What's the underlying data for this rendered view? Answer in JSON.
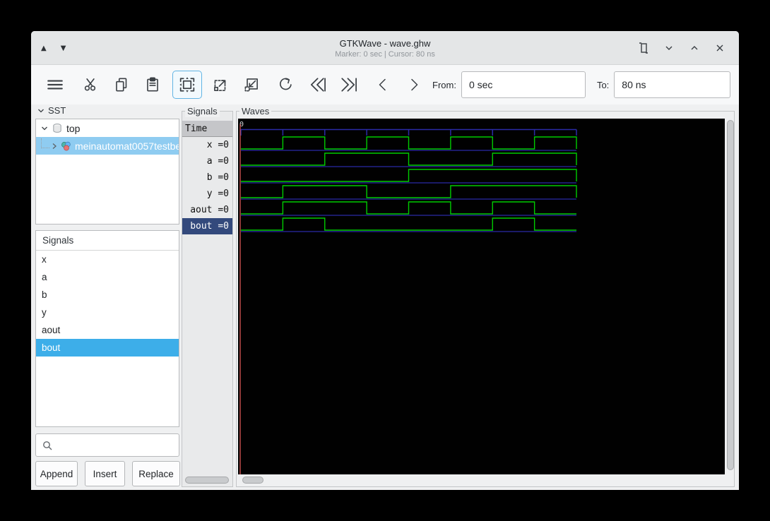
{
  "window": {
    "title": "GTKWave - wave.ghw",
    "subtitle": "Marker: 0 sec | Cursor: 80 ns"
  },
  "toolbar": {
    "from_label": "From:",
    "from_value": "0 sec",
    "to_label": "To:",
    "to_value": "80 ns"
  },
  "sst": {
    "label": "SST",
    "tree": [
      {
        "label": "top",
        "selected": false
      },
      {
        "label": "meinautomat0057testbe",
        "selected": true
      }
    ]
  },
  "signal_list": {
    "header": "Signals",
    "items": [
      "x",
      "a",
      "b",
      "y",
      "aout",
      "bout"
    ],
    "selected": "bout"
  },
  "actions": {
    "append": "Append",
    "insert": "Insert",
    "replace": "Replace"
  },
  "signals_panel": {
    "frame_label": "Signals",
    "time_header": "Time",
    "rows": [
      {
        "text": "x =0",
        "selected": false
      },
      {
        "text": "a =0",
        "selected": false
      },
      {
        "text": "b =0",
        "selected": false
      },
      {
        "text": "y =0",
        "selected": false
      },
      {
        "text": "aout =0",
        "selected": false
      },
      {
        "text": "bout =0",
        "selected": true
      }
    ]
  },
  "waves": {
    "frame_label": "Waves",
    "time_start_label": "0",
    "time_unit": "ns",
    "t_end": 80,
    "tick_interval": 10,
    "colors": {
      "trace": "#00cc00",
      "baseline": "#2b2ba6",
      "marker": "#c9514e",
      "time_text": "#d8d8d8"
    },
    "signals": [
      {
        "name": "x",
        "initial": 0,
        "toggles": [
          10,
          20,
          30,
          40,
          50,
          60,
          70
        ]
      },
      {
        "name": "a",
        "initial": 0,
        "toggles": [
          20,
          40,
          60
        ]
      },
      {
        "name": "b",
        "initial": 0,
        "toggles": [
          40
        ]
      },
      {
        "name": "y",
        "initial": 0,
        "toggles": [
          10,
          30,
          50
        ]
      },
      {
        "name": "aout",
        "initial": 0,
        "toggles": [
          10,
          30,
          40,
          50,
          60,
          70
        ]
      },
      {
        "name": "bout",
        "initial": 0,
        "toggles": [
          10,
          20,
          60,
          70
        ]
      }
    ]
  }
}
